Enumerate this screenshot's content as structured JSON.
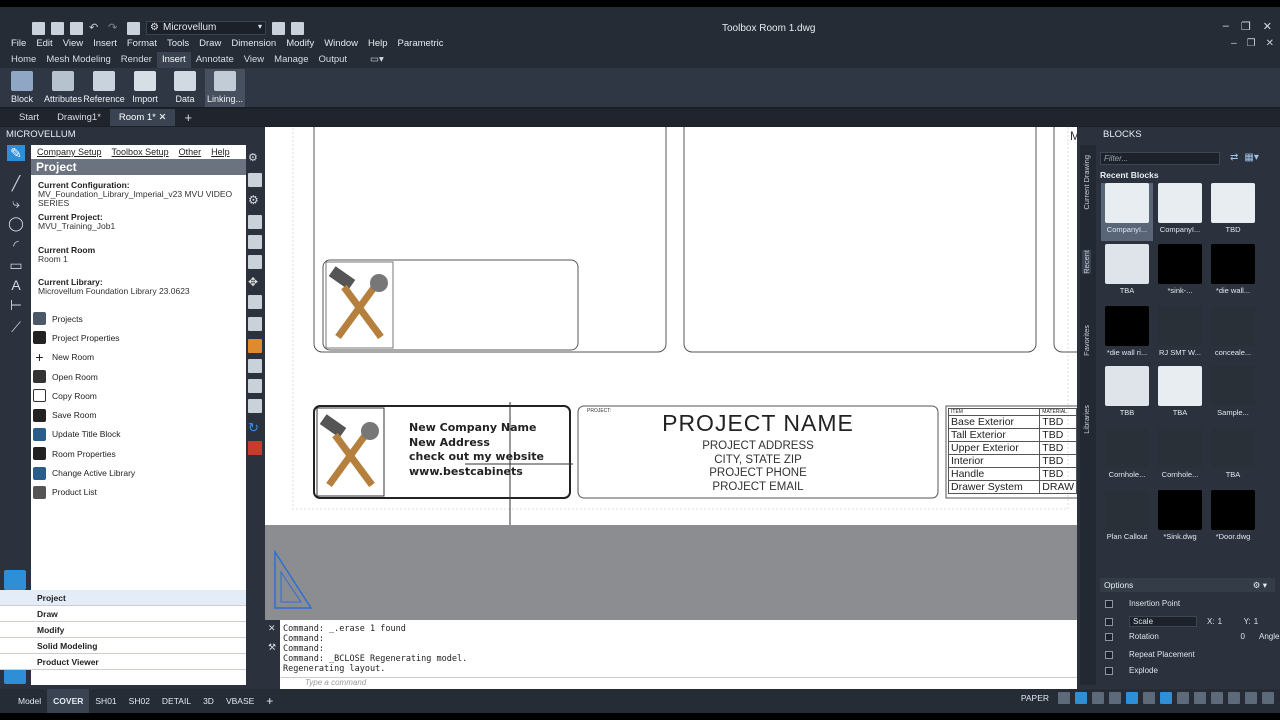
{
  "app": {
    "title": "Toolbox Room 1.dwg",
    "workspace": "Microvellum"
  },
  "menu": [
    "File",
    "Edit",
    "View",
    "Insert",
    "Format",
    "Tools",
    "Draw",
    "Dimension",
    "Modify",
    "Window",
    "Help",
    "Parametric"
  ],
  "ribbon_tabs": [
    "Home",
    "Mesh Modeling",
    "Render",
    "Insert",
    "Annotate",
    "View",
    "Manage",
    "Output"
  ],
  "ribbon_active": "Insert",
  "ribbon_buttons": [
    "Block",
    "Attributes",
    "Reference",
    "Import",
    "Data",
    "Linking..."
  ],
  "doc_tabs": [
    "Start",
    "Drawing1*",
    "Room 1*"
  ],
  "palette": {
    "title": "MICROVELLUM",
    "menu": [
      "Company Setup",
      "Toolbox Setup",
      "Other",
      "Help"
    ],
    "section": "Project",
    "config_label": "Current Configuration:",
    "config_value": "MV_Foundation_Library_Imperial_v23 MVU VIDEO SERIES",
    "project_label": "Current Project:",
    "project_value": "MVU_Training_Job1",
    "room_label": "Current Room",
    "room_value": "Room 1",
    "library_label": "Current Library:",
    "library_value": "Microvellum Foundation Library 23.0623",
    "items": [
      "Projects",
      "Project Properties",
      "New Room",
      "Open Room",
      "Copy Room",
      "Save Room",
      "Update Title Block",
      "Room Properties",
      "Change Active Library",
      "Product List"
    ],
    "categories": [
      "Project",
      "Draw",
      "Modify",
      "Solid Modeling",
      "Product Viewer"
    ]
  },
  "titleblock": {
    "company": [
      "New Company Name",
      "New Address",
      "check out my website",
      "www.bestcabinets"
    ],
    "project_tag": "PROJECT:",
    "project_name": "PROJECT NAME",
    "project_lines": [
      "PROJECT ADDRESS",
      "CITY, STATE ZIP",
      "PROJECT PHONE",
      "PROJECT EMAIL"
    ],
    "table_headers": [
      "ITEM",
      "MATERIAL"
    ],
    "table_rows": [
      [
        "Base Exterior",
        "TBD"
      ],
      [
        "Tall Exterior",
        "TBD"
      ],
      [
        "Upper Exterior",
        "TBD"
      ],
      [
        "Interior",
        "TBD"
      ],
      [
        "Handle",
        "TBD"
      ],
      [
        "Drawer System",
        "DRAW"
      ]
    ],
    "corner_letter": "M"
  },
  "command": {
    "lines": [
      "Command: _.erase 1 found",
      "Command:",
      "Command:",
      "Command: _BCLOSE Regenerating model.",
      "Regenerating layout."
    ],
    "placeholder": "Type a command"
  },
  "blocks": {
    "title": "BLOCKS",
    "filter_placeholder": "Filter...",
    "recent_label": "Recent Blocks",
    "vertical_tabs": [
      "Current Drawing",
      "Recent",
      "Favorites",
      "Libraries"
    ],
    "items": [
      "CompanyI...",
      "CompanyI...",
      "TBD",
      "TBA",
      "*sink-...",
      "*die wall...",
      "*die wall ri...",
      "RJ SMT W...",
      "conceale...",
      "TBB",
      "TBA",
      "Sample...",
      "Cornhole...",
      "Cornhole...",
      "TBA",
      "Plan Callout",
      "*Sink.dwg",
      "*Door.dwg"
    ],
    "options_label": "Options",
    "options": [
      "Insertion Point",
      "Scale",
      "Rotation",
      "Repeat Placement",
      "Explode"
    ],
    "scale_value": "Scale",
    "x_label": "X:",
    "x_value": "1",
    "y_label": "Y:",
    "y_value": "1",
    "rotation_value": "0",
    "angle_label": "Angle"
  },
  "status": {
    "layouts": [
      "Model",
      "COVER",
      "SH01",
      "SH02",
      "DETAIL",
      "3D",
      "VBASE"
    ],
    "active": "COVER",
    "space": "PAPER"
  }
}
